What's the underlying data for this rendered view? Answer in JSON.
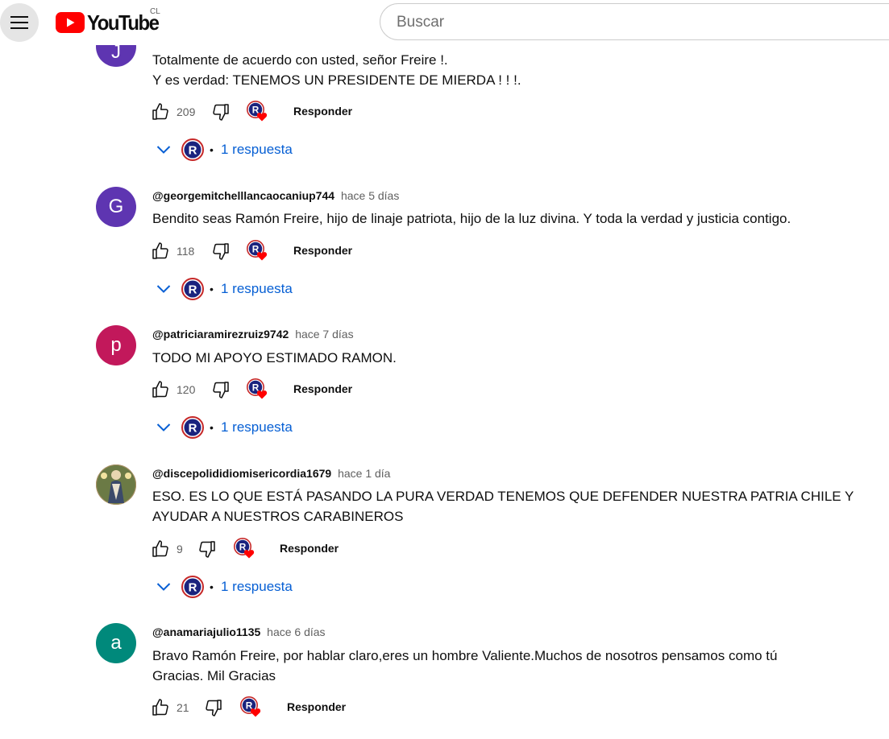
{
  "header": {
    "logo_text": "YouTube",
    "country": "CL",
    "search_placeholder": "Buscar"
  },
  "colors": {
    "accent_link": "#065fd4",
    "brand_red": "#ff0000",
    "avatar_G": "#5e35b1",
    "avatar_p": "#c2185b",
    "avatar_a": "#00897b",
    "avatar_top": "#5e35b1"
  },
  "comments": [
    {
      "author": "",
      "time": "",
      "avatar_letter": "J",
      "text_lines": [
        "Totalmente de acuerdo con usted, señor Freire !.",
        "Y es verdad: TENEMOS UN PRESIDENTE DE MIERDA ! ! !."
      ],
      "likes": "209",
      "reply_label": "Responder",
      "replies_label": "1 respuesta"
    },
    {
      "author": "@georgemitchelllancaocaniup744",
      "time": "hace 5 días",
      "avatar_letter": "G",
      "text_lines": [
        "Bendito seas Ramón Freire, hijo de linaje patriota, hijo de la luz divina. Y toda la verdad y justicia contigo."
      ],
      "likes": "118",
      "reply_label": "Responder",
      "replies_label": "1 respuesta"
    },
    {
      "author": "@patriciaramirezruiz9742",
      "time": "hace 7 días",
      "avatar_letter": "p",
      "text_lines": [
        "TODO MI APOYO ESTIMADO RAMON."
      ],
      "likes": "120",
      "reply_label": "Responder",
      "replies_label": "1 respuesta"
    },
    {
      "author": "@discepolididiomisericordia1679",
      "time": "hace 1 día",
      "avatar_letter": "",
      "text_lines": [
        "ESO. ES LO QUE ESTÁ PASANDO LA PURA VERDAD TENEMOS QUE DEFENDER NUESTRA PATRIA CHILE Y",
        "AYUDAR A NUESTROS CARABINEROS"
      ],
      "likes": "9",
      "reply_label": "Responder",
      "replies_label": "1 respuesta"
    },
    {
      "author": "@anamariajulio1135",
      "time": "hace 6 días",
      "avatar_letter": "a",
      "text_lines": [
        "Bravo Ramón Freire,  por hablar claro,eres un hombre Valiente.Muchos de nosotros pensamos como tú",
        "Gracias. Mil Gracias"
      ],
      "likes": "21",
      "reply_label": "Responder",
      "replies_label": ""
    }
  ]
}
